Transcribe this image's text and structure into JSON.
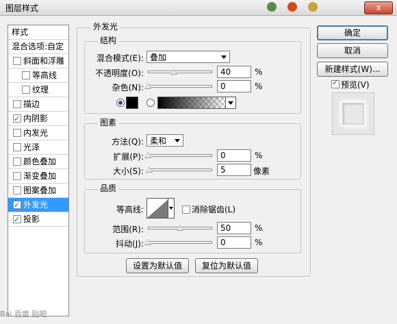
{
  "window": {
    "title": "图层样式",
    "close_label": "x"
  },
  "sidebar": {
    "header1": "样式",
    "header2": "混合选项:自定",
    "items": [
      {
        "label": "斜面和浮雕",
        "checked": false
      },
      {
        "label": "等高线",
        "checked": false
      },
      {
        "label": "纹理",
        "checked": false
      },
      {
        "label": "描边",
        "checked": false
      },
      {
        "label": "内阴影",
        "checked": true
      },
      {
        "label": "内发光",
        "checked": false
      },
      {
        "label": "光泽",
        "checked": false
      },
      {
        "label": "颜色叠加",
        "checked": false
      },
      {
        "label": "渐变叠加",
        "checked": false
      },
      {
        "label": "图案叠加",
        "checked": false
      },
      {
        "label": "外发光",
        "checked": true,
        "selected": true
      },
      {
        "label": "投影",
        "checked": true
      }
    ]
  },
  "panel": {
    "title": "外发光",
    "structure": {
      "title": "结构",
      "blend_mode_label": "混合模式(E):",
      "blend_mode_value": "叠加",
      "opacity_label": "不透明度(O):",
      "opacity_value": "40",
      "opacity_unit": "%",
      "opacity_fraction": 0.4,
      "noise_label": "杂色(N):",
      "noise_value": "0",
      "noise_unit": "%",
      "noise_fraction": 0.0,
      "color_mode": "solid",
      "color": "#000000"
    },
    "elements": {
      "title": "图素",
      "method_label": "方法(Q):",
      "method_value": "柔和",
      "spread_label": "扩展(P):",
      "spread_value": "0",
      "spread_unit": "%",
      "spread_fraction": 0.0,
      "size_label": "大小(S):",
      "size_value": "5",
      "size_unit": "像素",
      "size_fraction": 0.02
    },
    "quality": {
      "title": "品质",
      "contour_label": "等高线:",
      "antialias_label": "消除锯齿(L)",
      "antialias_checked": false,
      "range_label": "范围(R):",
      "range_value": "50",
      "range_unit": "%",
      "range_fraction": 0.5,
      "jitter_label": "抖动(J):",
      "jitter_value": "0",
      "jitter_unit": "%",
      "jitter_fraction": 0.0
    },
    "make_default": "设置为默认值",
    "reset_default": "复位为默认值"
  },
  "buttons": {
    "ok": "确定",
    "cancel": "取消",
    "new_style": "新建样式(W)...",
    "preview_label": "预览(V)",
    "preview_checked": true
  },
  "watermark": "Bai 百度 贴吧"
}
